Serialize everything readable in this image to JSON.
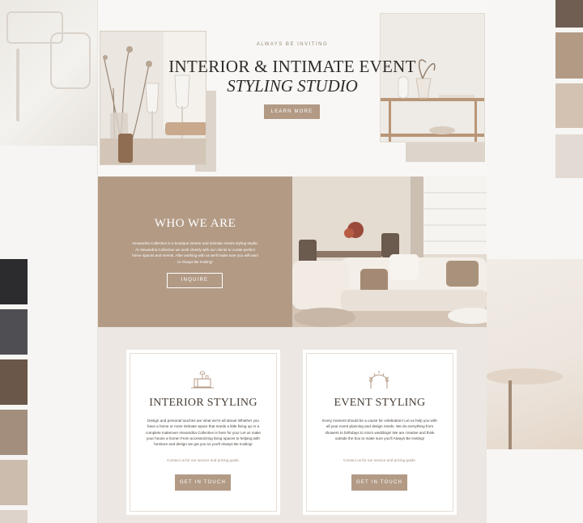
{
  "hero": {
    "eyebrow": "ALWAYS BE INVITING",
    "title_line1": "INTERIOR & INTIMATE EVENT",
    "title_line2": "STYLING STUDIO",
    "cta_label": "LEARN MORE"
  },
  "about": {
    "title": "WHO WE ARE",
    "text": "Alexandria Collective is a boutique interior and intimate events styling studio. At Alexandria Collective we work closely with our clients to curate perfect home spaces and events. After working with us we'll make sure you will want to Always Be Inviting!",
    "cta_label": "INQUIRE"
  },
  "services": [
    {
      "title": "INTERIOR STYLING",
      "icon": "furniture-icon",
      "text": "Design and personal touches are what we're all about! Whether you have a home or more intimate space that needs a little fixing up or a complete makeover Alexandria Collective is here for you! Let us make your house a home! From accessorizing living spaces to helping with furniture and design we got you so you'll Always Be Inviting!",
      "link": "Contact us for our service and pricing guide.",
      "cta_label": "GET IN TOUCH"
    },
    {
      "title": "EVENT STYLING",
      "icon": "arch-icon",
      "text": "Every moment should be a cause for celebration! Let us help you with all your event planning and design needs. We do everything from showers to birthdays to micro weddings! We are creative and think outside the box to make sure you'll Always Be Inviting!",
      "link": "Contact us for our service and pricing guide.",
      "cta_label": "GET IN TOUCH"
    }
  ],
  "palette": {
    "right_top": [
      "#6f5e51",
      "#b29a85",
      "#d3c2b2",
      "#e3dad3"
    ],
    "left_bottom": [
      "#2c2b2e",
      "#4f4e53",
      "#6a5749",
      "#a38e7e",
      "#cbbcad",
      "#ddd3ca"
    ]
  }
}
